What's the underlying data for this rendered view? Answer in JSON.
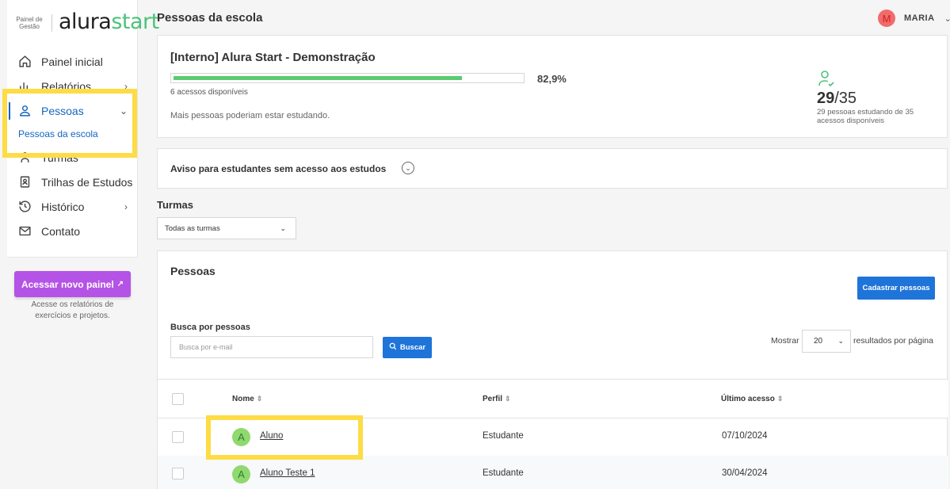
{
  "logo": {
    "small_text_line1": "Painel de",
    "small_text_line2": "Gestão",
    "brand_a": "alura",
    "brand_b": "start"
  },
  "sidebar": {
    "items": [
      {
        "label": "Painel inicial",
        "icon": "home-icon"
      },
      {
        "label": "Relatórios",
        "icon": "bar-chart-icon"
      },
      {
        "label": "Pessoas",
        "icon": "user-icon"
      },
      {
        "label": "Turmas",
        "icon": "group-icon"
      },
      {
        "label": "Trilhas de Estudos",
        "icon": "book-icon"
      },
      {
        "label": "Histórico",
        "icon": "history-icon"
      },
      {
        "label": "Contato",
        "icon": "mail-icon"
      }
    ],
    "subitem_label": "Pessoas da escola",
    "new_panel_button": "Acessar novo painel",
    "new_panel_hint": "Acesse os relatórios de exercícios e projetos."
  },
  "header": {
    "title": "Pessoas da escola",
    "user_initial": "M",
    "user_name": "MARIA"
  },
  "school_card": {
    "name": "[Interno] Alura Start - Demonstração",
    "progress_fraction": 0.829,
    "progress_label": "82,9%",
    "available_text": "6 acessos disponíveis",
    "message": "Mais pessoas poderiam estar estudando.",
    "stat_count": "29",
    "stat_total": "/35",
    "stat_caption": "29 pessoas estudando de 35 acessos disponíveis"
  },
  "notice": {
    "label": "Aviso para estudantes sem acesso aos estudos"
  },
  "turmas": {
    "label": "Turmas",
    "selected": "Todas as turmas"
  },
  "people": {
    "title": "Pessoas",
    "register_button": "Cadastrar pessoas",
    "search_label": "Busca por pessoas",
    "search_placeholder": "Busca por e-mail",
    "search_button": "Buscar",
    "show_label": "Mostrar",
    "page_size": "20",
    "per_page_label": "resultados por página",
    "columns": {
      "name": "Nome",
      "profile": "Perfil",
      "last_access": "Último acesso"
    },
    "rows": [
      {
        "initial": "A",
        "name": "Aluno",
        "profile": "Estudante",
        "last_access": "07/10/2024"
      },
      {
        "initial": "A",
        "name": "Aluno Teste 1",
        "profile": "Estudante",
        "last_access": "30/04/2024"
      }
    ]
  },
  "colors": {
    "accent": "#1e74d8",
    "highlight": "#fddc45",
    "progress": "#5bcb71",
    "new_panel": "#b453e6"
  }
}
